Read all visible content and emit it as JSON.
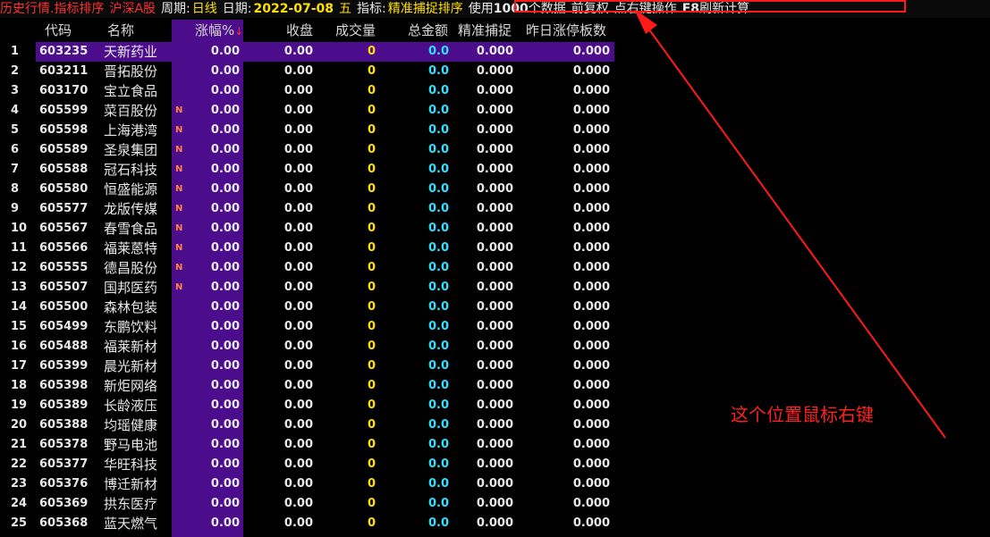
{
  "topbar": {
    "part1": "历史行情.指标排序",
    "part2": "沪深A股",
    "period_label": "周期:",
    "period": "日线",
    "date_label": "日期:",
    "date": "2022-07-08",
    "weekday": "五",
    "indicator_label": "指标:",
    "indicator": "精准捕捉排序",
    "usage_pre": "使用",
    "usage_num": "1000",
    "usage_post": "个数据",
    "adjust": "前复权",
    "hint": "点右键操作",
    "refresh_key": "F8",
    "refresh_text": "刷新计算"
  },
  "columns": {
    "code": "代码",
    "name": "名称",
    "change": "涨幅%",
    "sort_arrow": "↓",
    "close": "收盘",
    "volume": "成交量",
    "amount": "总金额",
    "capture": "精准捕捉",
    "limitup": "昨日涨停板数"
  },
  "annotation": "这个位置鼠标右键",
  "colors": {
    "accent_purple": "#4b0d8c",
    "annotation_red": "#ff2020",
    "volume_yellow": "#ffe000",
    "amount_cyan": "#30e0ff"
  },
  "rows": [
    {
      "idx": "1",
      "code": "603235",
      "name": "天新药业",
      "flag": "",
      "change": "0.00",
      "close": "0.00",
      "volume": "0",
      "amount": "0.0",
      "capture": "0.000",
      "limitup": "0.000"
    },
    {
      "idx": "2",
      "code": "603211",
      "name": "晋拓股份",
      "flag": "",
      "change": "0.00",
      "close": "0.00",
      "volume": "0",
      "amount": "0.0",
      "capture": "0.000",
      "limitup": "0.000"
    },
    {
      "idx": "3",
      "code": "603170",
      "name": "宝立食品",
      "flag": "",
      "change": "0.00",
      "close": "0.00",
      "volume": "0",
      "amount": "0.0",
      "capture": "0.000",
      "limitup": "0.000"
    },
    {
      "idx": "4",
      "code": "605599",
      "name": "菜百股份",
      "flag": "N",
      "change": "0.00",
      "close": "0.00",
      "volume": "0",
      "amount": "0.0",
      "capture": "0.000",
      "limitup": "0.000"
    },
    {
      "idx": "5",
      "code": "605598",
      "name": "上海港湾",
      "flag": "N",
      "change": "0.00",
      "close": "0.00",
      "volume": "0",
      "amount": "0.0",
      "capture": "0.000",
      "limitup": "0.000"
    },
    {
      "idx": "6",
      "code": "605589",
      "name": "圣泉集团",
      "flag": "N",
      "change": "0.00",
      "close": "0.00",
      "volume": "0",
      "amount": "0.0",
      "capture": "0.000",
      "limitup": "0.000"
    },
    {
      "idx": "7",
      "code": "605588",
      "name": "冠石科技",
      "flag": "N",
      "change": "0.00",
      "close": "0.00",
      "volume": "0",
      "amount": "0.0",
      "capture": "0.000",
      "limitup": "0.000"
    },
    {
      "idx": "8",
      "code": "605580",
      "name": "恒盛能源",
      "flag": "N",
      "change": "0.00",
      "close": "0.00",
      "volume": "0",
      "amount": "0.0",
      "capture": "0.000",
      "limitup": "0.000"
    },
    {
      "idx": "9",
      "code": "605577",
      "name": "龙版传媒",
      "flag": "N",
      "change": "0.00",
      "close": "0.00",
      "volume": "0",
      "amount": "0.0",
      "capture": "0.000",
      "limitup": "0.000"
    },
    {
      "idx": "10",
      "code": "605567",
      "name": "春雪食品",
      "flag": "N",
      "change": "0.00",
      "close": "0.00",
      "volume": "0",
      "amount": "0.0",
      "capture": "0.000",
      "limitup": "0.000"
    },
    {
      "idx": "11",
      "code": "605566",
      "name": "福莱蒽特",
      "flag": "N",
      "change": "0.00",
      "close": "0.00",
      "volume": "0",
      "amount": "0.0",
      "capture": "0.000",
      "limitup": "0.000"
    },
    {
      "idx": "12",
      "code": "605555",
      "name": "德昌股份",
      "flag": "N",
      "change": "0.00",
      "close": "0.00",
      "volume": "0",
      "amount": "0.0",
      "capture": "0.000",
      "limitup": "0.000"
    },
    {
      "idx": "13",
      "code": "605507",
      "name": "国邦医药",
      "flag": "N",
      "change": "0.00",
      "close": "0.00",
      "volume": "0",
      "amount": "0.0",
      "capture": "0.000",
      "limitup": "0.000"
    },
    {
      "idx": "14",
      "code": "605500",
      "name": "森林包装",
      "flag": "",
      "change": "0.00",
      "close": "0.00",
      "volume": "0",
      "amount": "0.0",
      "capture": "0.000",
      "limitup": "0.000"
    },
    {
      "idx": "15",
      "code": "605499",
      "name": "东鹏饮料",
      "flag": "",
      "change": "0.00",
      "close": "0.00",
      "volume": "0",
      "amount": "0.0",
      "capture": "0.000",
      "limitup": "0.000"
    },
    {
      "idx": "16",
      "code": "605488",
      "name": "福莱新材",
      "flag": "",
      "change": "0.00",
      "close": "0.00",
      "volume": "0",
      "amount": "0.0",
      "capture": "0.000",
      "limitup": "0.000"
    },
    {
      "idx": "17",
      "code": "605399",
      "name": "晨光新材",
      "flag": "",
      "change": "0.00",
      "close": "0.00",
      "volume": "0",
      "amount": "0.0",
      "capture": "0.000",
      "limitup": "0.000"
    },
    {
      "idx": "18",
      "code": "605398",
      "name": "新炬网络",
      "flag": "",
      "change": "0.00",
      "close": "0.00",
      "volume": "0",
      "amount": "0.0",
      "capture": "0.000",
      "limitup": "0.000"
    },
    {
      "idx": "19",
      "code": "605389",
      "name": "长龄液压",
      "flag": "",
      "change": "0.00",
      "close": "0.00",
      "volume": "0",
      "amount": "0.0",
      "capture": "0.000",
      "limitup": "0.000"
    },
    {
      "idx": "20",
      "code": "605388",
      "name": "均瑶健康",
      "flag": "",
      "change": "0.00",
      "close": "0.00",
      "volume": "0",
      "amount": "0.0",
      "capture": "0.000",
      "limitup": "0.000"
    },
    {
      "idx": "21",
      "code": "605378",
      "name": "野马电池",
      "flag": "",
      "change": "0.00",
      "close": "0.00",
      "volume": "0",
      "amount": "0.0",
      "capture": "0.000",
      "limitup": "0.000"
    },
    {
      "idx": "22",
      "code": "605377",
      "name": "华旺科技",
      "flag": "",
      "change": "0.00",
      "close": "0.00",
      "volume": "0",
      "amount": "0.0",
      "capture": "0.000",
      "limitup": "0.000"
    },
    {
      "idx": "23",
      "code": "605376",
      "name": "博迁新材",
      "flag": "",
      "change": "0.00",
      "close": "0.00",
      "volume": "0",
      "amount": "0.0",
      "capture": "0.000",
      "limitup": "0.000"
    },
    {
      "idx": "24",
      "code": "605369",
      "name": "拱东医疗",
      "flag": "",
      "change": "0.00",
      "close": "0.00",
      "volume": "0",
      "amount": "0.0",
      "capture": "0.000",
      "limitup": "0.000"
    },
    {
      "idx": "25",
      "code": "605368",
      "name": "蓝天燃气",
      "flag": "",
      "change": "0.00",
      "close": "0.00",
      "volume": "0",
      "amount": "0.0",
      "capture": "0.000",
      "limitup": "0.000"
    }
  ]
}
